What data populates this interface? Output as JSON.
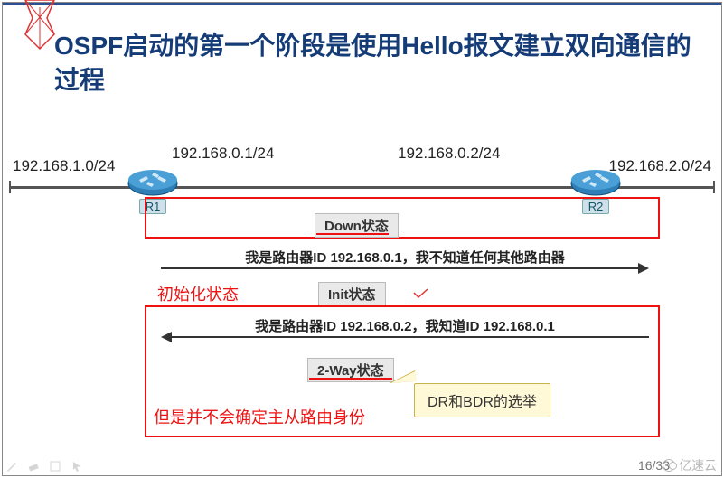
{
  "title": "OSPF启动的第一个阶段是使用Hello报文建立双向通信的过程",
  "ips": {
    "leftNet": "192.168.1.0/24",
    "r1": "192.168.0.1/24",
    "r2": "192.168.0.2/24",
    "rightNet": "192.168.2.0/24"
  },
  "routers": {
    "r1": "R1",
    "r2": "R2"
  },
  "states": {
    "down": "Down状态",
    "init": "Init状态",
    "twoway": "2-Way状态"
  },
  "messages": {
    "m1": "我是路由器ID 192.168.0.1，我不知道任何其他路由器",
    "m2": "我是路由器ID 192.168.0.2，我知道ID 192.168.0.1"
  },
  "annotations": {
    "initNote": "初始化状态",
    "twowayNote": "但是并不会确定主从路由身份"
  },
  "callout": "DR和BDR的选举",
  "pager": "16/33",
  "watermark": "亿速云"
}
